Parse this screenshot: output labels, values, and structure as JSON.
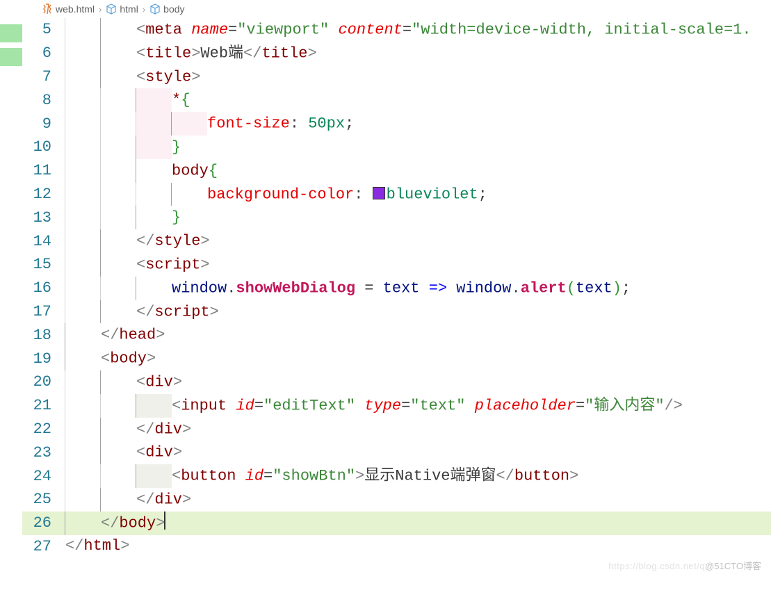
{
  "breadcrumbs": [
    {
      "icon": "file",
      "label": "web.html"
    },
    {
      "icon": "cube",
      "label": "html"
    },
    {
      "icon": "cube",
      "label": "body"
    }
  ],
  "watermark": {
    "faint": "https://blog.csdn.net/q",
    "text": "@51CTO博客"
  },
  "lines": [
    {
      "num": "5",
      "indent": 2,
      "tokens": [
        {
          "t": "<",
          "c": "vs-angle"
        },
        {
          "t": "meta",
          "c": "vs-tagname"
        },
        {
          "t": " ",
          "c": ""
        },
        {
          "t": "name",
          "c": "vs-attr"
        },
        {
          "t": "=",
          "c": "vs-eq"
        },
        {
          "t": "\"viewport\"",
          "c": "vs-str"
        },
        {
          "t": " ",
          "c": ""
        },
        {
          "t": "content",
          "c": "vs-attr"
        },
        {
          "t": "=",
          "c": "vs-eq"
        },
        {
          "t": "\"width=device-width, initial-scale=1.",
          "c": "vs-str"
        }
      ]
    },
    {
      "num": "6",
      "indent": 2,
      "tokens": [
        {
          "t": "<",
          "c": "vs-angle"
        },
        {
          "t": "title",
          "c": "vs-tagname"
        },
        {
          "t": ">",
          "c": "vs-angle"
        },
        {
          "t": "Web端",
          "c": "vs-txt"
        },
        {
          "t": "</",
          "c": "vs-angle"
        },
        {
          "t": "title",
          "c": "vs-tagname"
        },
        {
          "t": ">",
          "c": "vs-angle"
        }
      ]
    },
    {
      "num": "7",
      "indent": 2,
      "tokens": [
        {
          "t": "<",
          "c": "vs-angle"
        },
        {
          "t": "style",
          "c": "vs-tagname"
        },
        {
          "t": ">",
          "c": "vs-angle"
        }
      ]
    },
    {
      "num": "8",
      "indent": 3,
      "guidefill": "p",
      "tokens": [
        {
          "t": "*",
          "c": "vs-sel"
        },
        {
          "t": "{",
          "c": "vs-par"
        }
      ]
    },
    {
      "num": "9",
      "indent": 4,
      "guidefill": "p",
      "tokens": [
        {
          "t": "font-size",
          "c": "vs-prop"
        },
        {
          "t": ": ",
          "c": "vs-txt"
        },
        {
          "t": "50",
          "c": "vs-num"
        },
        {
          "t": "px",
          "c": "vs-num"
        },
        {
          "t": ";",
          "c": "vs-txt"
        }
      ]
    },
    {
      "num": "10",
      "indent": 3,
      "guidefill": "p",
      "tokens": [
        {
          "t": "}",
          "c": "vs-par"
        }
      ]
    },
    {
      "num": "11",
      "indent": 3,
      "tokens": [
        {
          "t": "body",
          "c": "vs-sel"
        },
        {
          "t": "{",
          "c": "vs-par"
        }
      ]
    },
    {
      "num": "12",
      "indent": 4,
      "tokens": [
        {
          "t": "background-color",
          "c": "vs-prop"
        },
        {
          "t": ": ",
          "c": "vs-txt"
        },
        {
          "t": "[SW]",
          "c": "swatch"
        },
        {
          "t": "blueviolet",
          "c": "vs-green"
        },
        {
          "t": ";",
          "c": "vs-txt"
        }
      ]
    },
    {
      "num": "13",
      "indent": 3,
      "tokens": [
        {
          "t": "}",
          "c": "vs-par"
        }
      ]
    },
    {
      "num": "14",
      "indent": 2,
      "tokens": [
        {
          "t": "</",
          "c": "vs-angle"
        },
        {
          "t": "style",
          "c": "vs-tagname"
        },
        {
          "t": ">",
          "c": "vs-angle"
        }
      ]
    },
    {
      "num": "15",
      "indent": 2,
      "tokens": [
        {
          "t": "<",
          "c": "vs-angle"
        },
        {
          "t": "script",
          "c": "vs-tagname"
        },
        {
          "t": ">",
          "c": "vs-angle"
        }
      ]
    },
    {
      "num": "16",
      "indent": 3,
      "tokens": [
        {
          "t": "window",
          "c": "vs-ident"
        },
        {
          "t": ".",
          "c": "vs-txt"
        },
        {
          "t": "showWebDialog",
          "c": "vs-funcbold"
        },
        {
          "t": " = ",
          "c": "vs-txt"
        },
        {
          "t": "text",
          "c": "vs-ident"
        },
        {
          "t": " ",
          "c": ""
        },
        {
          "t": "=>",
          "c": "vs-kw"
        },
        {
          "t": " ",
          "c": ""
        },
        {
          "t": "window",
          "c": "vs-ident"
        },
        {
          "t": ".",
          "c": "vs-txt"
        },
        {
          "t": "alert",
          "c": "vs-funcbold"
        },
        {
          "t": "(",
          "c": "vs-par"
        },
        {
          "t": "text",
          "c": "vs-ident"
        },
        {
          "t": ")",
          "c": "vs-par"
        },
        {
          "t": ";",
          "c": "vs-txt"
        }
      ]
    },
    {
      "num": "17",
      "indent": 2,
      "tokens": [
        {
          "t": "</",
          "c": "vs-angle"
        },
        {
          "t": "script",
          "c": "vs-tagname"
        },
        {
          "t": ">",
          "c": "vs-angle"
        }
      ]
    },
    {
      "num": "18",
      "indent": 1,
      "tokens": [
        {
          "t": "</",
          "c": "vs-angle"
        },
        {
          "t": "head",
          "c": "vs-tagname"
        },
        {
          "t": ">",
          "c": "vs-angle"
        }
      ]
    },
    {
      "num": "19",
      "indent": 1,
      "tokens": [
        {
          "t": "<",
          "c": "vs-angle"
        },
        {
          "t": "body",
          "c": "vs-tagname"
        },
        {
          "t": ">",
          "c": "vs-angle"
        }
      ]
    },
    {
      "num": "20",
      "indent": 2,
      "tokens": [
        {
          "t": "<",
          "c": "vs-angle"
        },
        {
          "t": "div",
          "c": "vs-tagname"
        },
        {
          "t": ">",
          "c": "vs-angle"
        }
      ]
    },
    {
      "num": "21",
      "indent": 3,
      "guidefill": "g",
      "tokens": [
        {
          "t": "<",
          "c": "vs-angle"
        },
        {
          "t": "input",
          "c": "vs-tagname"
        },
        {
          "t": " ",
          "c": ""
        },
        {
          "t": "id",
          "c": "vs-attr"
        },
        {
          "t": "=",
          "c": "vs-eq"
        },
        {
          "t": "\"editText\"",
          "c": "vs-str"
        },
        {
          "t": " ",
          "c": ""
        },
        {
          "t": "type",
          "c": "vs-attr"
        },
        {
          "t": "=",
          "c": "vs-eq"
        },
        {
          "t": "\"text\"",
          "c": "vs-str"
        },
        {
          "t": " ",
          "c": ""
        },
        {
          "t": "placeholder",
          "c": "vs-attr"
        },
        {
          "t": "=",
          "c": "vs-eq"
        },
        {
          "t": "\"输入内容\"",
          "c": "vs-str"
        },
        {
          "t": "/>",
          "c": "vs-angle"
        }
      ]
    },
    {
      "num": "22",
      "indent": 2,
      "tokens": [
        {
          "t": "</",
          "c": "vs-angle"
        },
        {
          "t": "div",
          "c": "vs-tagname"
        },
        {
          "t": ">",
          "c": "vs-angle"
        }
      ]
    },
    {
      "num": "23",
      "indent": 2,
      "tokens": [
        {
          "t": "<",
          "c": "vs-angle"
        },
        {
          "t": "div",
          "c": "vs-tagname"
        },
        {
          "t": ">",
          "c": "vs-angle"
        }
      ]
    },
    {
      "num": "24",
      "indent": 3,
      "guidefill": "g",
      "tokens": [
        {
          "t": "<",
          "c": "vs-angle"
        },
        {
          "t": "button",
          "c": "vs-tagname"
        },
        {
          "t": " ",
          "c": ""
        },
        {
          "t": "id",
          "c": "vs-attr"
        },
        {
          "t": "=",
          "c": "vs-eq"
        },
        {
          "t": "\"showBtn\"",
          "c": "vs-str"
        },
        {
          "t": ">",
          "c": "vs-angle"
        },
        {
          "t": "显示Native端弹窗",
          "c": "vs-txt"
        },
        {
          "t": "</",
          "c": "vs-angle"
        },
        {
          "t": "button",
          "c": "vs-tagname"
        },
        {
          "t": ">",
          "c": "vs-angle"
        }
      ]
    },
    {
      "num": "25",
      "indent": 2,
      "tokens": [
        {
          "t": "</",
          "c": "vs-angle"
        },
        {
          "t": "div",
          "c": "vs-tagname"
        },
        {
          "t": ">",
          "c": "vs-angle"
        }
      ]
    },
    {
      "num": "26",
      "indent": 1,
      "highlighted": true,
      "cursor": true,
      "tokens": [
        {
          "t": "</",
          "c": "vs-angle"
        },
        {
          "t": "body",
          "c": "vs-tagname"
        },
        {
          "t": ">",
          "c": "vs-angle"
        }
      ]
    },
    {
      "num": "27",
      "indent": 0,
      "tokens": [
        {
          "t": "</",
          "c": "vs-angle"
        },
        {
          "t": "html",
          "c": "vs-tagname"
        },
        {
          "t": ">",
          "c": "vs-angle"
        }
      ]
    }
  ]
}
